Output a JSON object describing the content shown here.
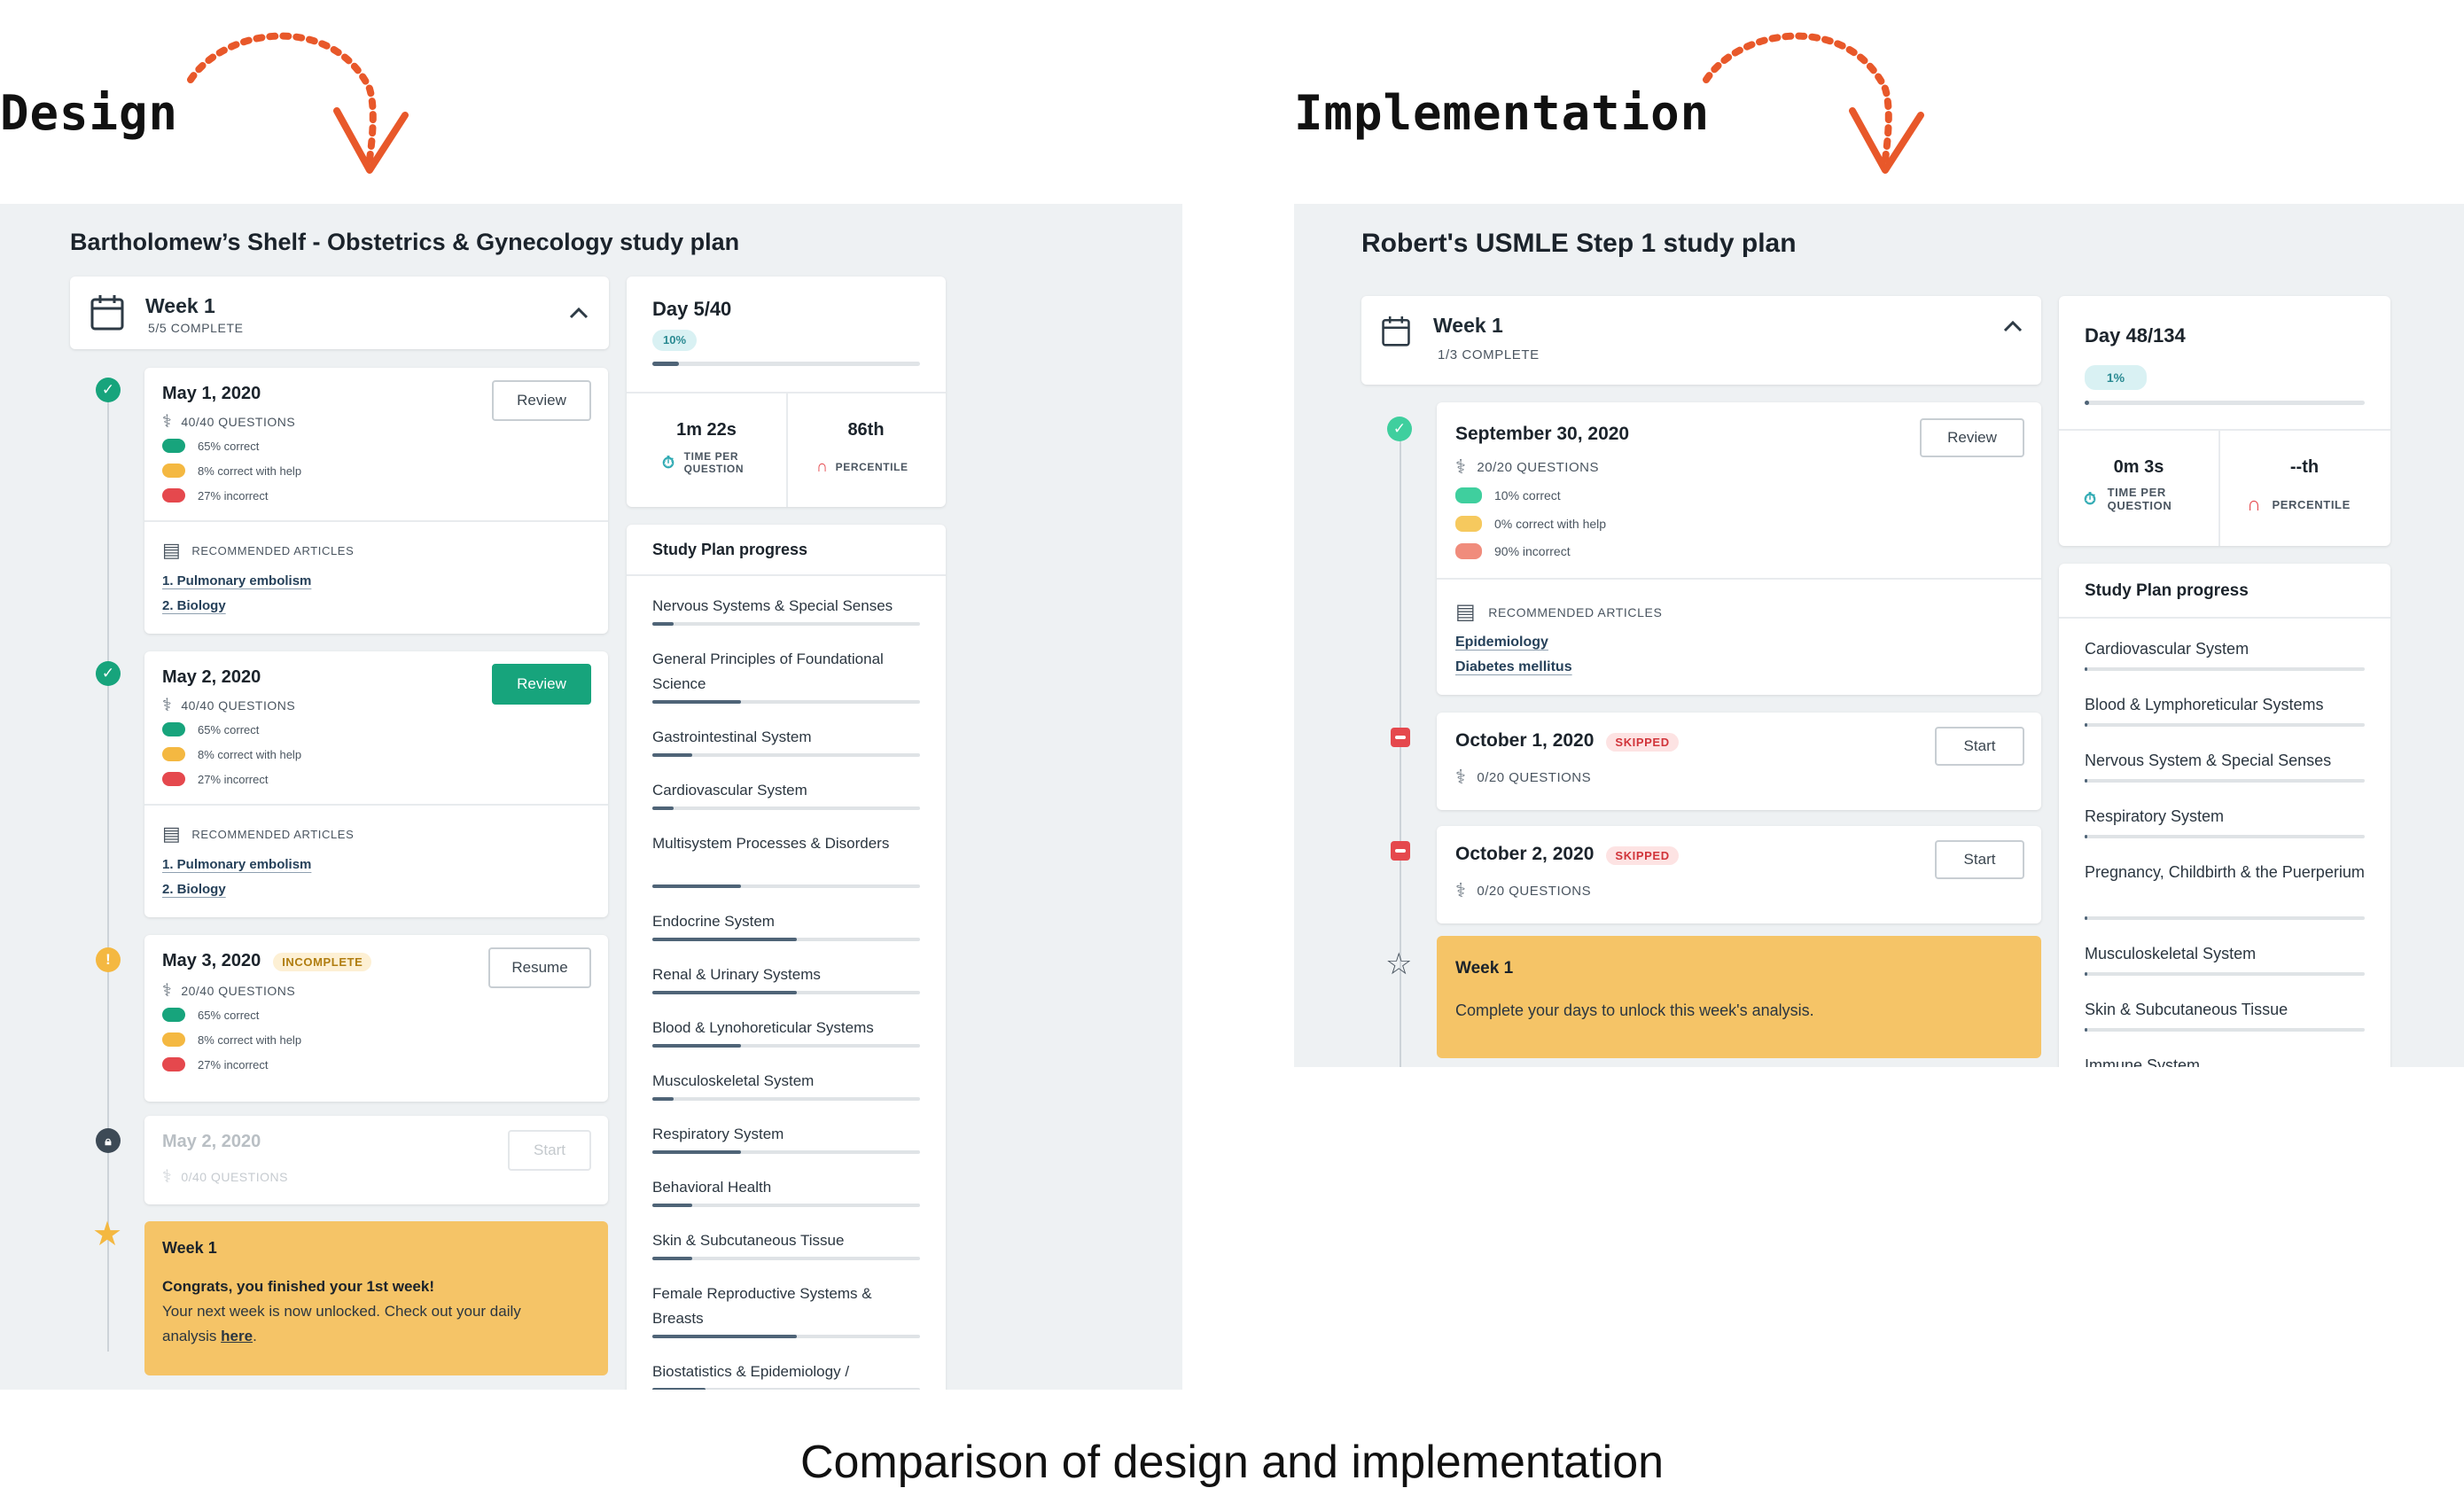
{
  "headings": {
    "design": "Design",
    "implementation": "Implementation"
  },
  "caption": "Comparison of design and implementation",
  "colors": {
    "accent_orange": "#e8582a",
    "correct": "#17a47c",
    "help": "#f4b841",
    "incorrect": "#e5484d",
    "week_card": "#f5c467",
    "panel_bg": "#eef1f3"
  },
  "design": {
    "plan_title": "Bartholomew’s Shelf - Obstetrics & Gynecology study plan",
    "week": {
      "title": "Week 1",
      "subtitle": "5/5 COMPLETE"
    },
    "days": [
      {
        "date": "May 1, 2020",
        "questions": "40/40 QUESTIONS",
        "correct": "65% correct",
        "help": "8% correct with help",
        "incorrect": "27% incorrect",
        "button": "Review",
        "articles_label": "RECOMMENDED ARTICLES",
        "articles": [
          "1. Pulmonary embolism",
          "2. Biology"
        ]
      },
      {
        "date": "May 2, 2020",
        "questions": "40/40 QUESTIONS",
        "correct": "65% correct",
        "help": "8% correct with help",
        "incorrect": "27% incorrect",
        "button": "Review",
        "articles_label": "RECOMMENDED ARTICLES",
        "articles": [
          "1. Pulmonary embolism",
          "2. Biology"
        ]
      },
      {
        "date": "May 3, 2020",
        "badge": "INCOMPLETE",
        "questions": "20/40 QUESTIONS",
        "correct": "65% correct",
        "help": "8% correct with help",
        "incorrect": "27% incorrect",
        "button": "Resume"
      },
      {
        "date": "May 2, 2020",
        "questions": "0/40 QUESTIONS",
        "button": "Start"
      }
    ],
    "week_card": {
      "title": "Week 1",
      "line1": "Congrats, you finished your 1st week!",
      "line2": "Your next week is now unlocked. Check out your daily",
      "line3_prefix": "analysis ",
      "line3_link": "here",
      "line3_suffix": "."
    },
    "day_progress": {
      "label": "Day 5/40",
      "pct_label": "10%",
      "progress": 0.1
    },
    "metrics": {
      "time_value": "1m 22s",
      "time_label_1": "TIME PER",
      "time_label_2": "QUESTION",
      "percentile_value": "86th",
      "percentile_label": "PERCENTILE"
    },
    "study_plan": {
      "title": "Study Plan progress",
      "items": [
        {
          "label": "Nervous Systems & Special Senses",
          "progress": 0.08
        },
        {
          "label": "General Principles of Foundational Science",
          "progress": 0.33
        },
        {
          "label": "Gastrointestinal System",
          "progress": 0.15
        },
        {
          "label": "Cardiovascular System",
          "progress": 0.08
        },
        {
          "label": "Multisystem Processes & Disorders",
          "progress": 0.33
        },
        {
          "label": "Endocrine System",
          "progress": 0.54
        },
        {
          "label": "Renal & Urinary Systems",
          "progress": 0.54
        },
        {
          "label": "Blood & Lynohoreticular Systems",
          "progress": 0.33
        },
        {
          "label": "Musculoskeletal System",
          "progress": 0.08
        },
        {
          "label": "Respiratory System",
          "progress": 0.33
        },
        {
          "label": "Behavioral Health",
          "progress": 0.15
        },
        {
          "label": "Skin & Subcutaneous Tissue",
          "progress": 0.15
        },
        {
          "label": "Female Reproductive Systems & Breasts",
          "progress": 0.54
        },
        {
          "label": "Biostatistics & Epidemiology /",
          "progress": 0.2
        }
      ]
    }
  },
  "implementation": {
    "plan_title": "Robert's USMLE Step 1 study plan",
    "week": {
      "title": "Week 1",
      "subtitle": "1/3 COMPLETE"
    },
    "days": [
      {
        "date": "September 30, 2020",
        "questions": "20/20 QUESTIONS",
        "correct": "10% correct",
        "help": "0% correct with help",
        "incorrect": "90% incorrect",
        "button": "Review",
        "articles_label": "RECOMMENDED ARTICLES",
        "articles": [
          "Epidemiology",
          "Diabetes mellitus"
        ]
      },
      {
        "date": "October 1, 2020",
        "badge": "SKIPPED",
        "questions": "0/20 QUESTIONS",
        "button": "Start"
      },
      {
        "date": "October 2, 2020",
        "badge": "SKIPPED",
        "questions": "0/20 QUESTIONS",
        "button": "Start"
      }
    ],
    "week_card": {
      "title": "Week 1",
      "line1": "Complete your days to unlock this week's analysis."
    },
    "day_progress": {
      "label": "Day 48/134",
      "pct_label": "1%",
      "progress": 0.01
    },
    "metrics": {
      "time_value": "0m 3s",
      "time_label_1": "TIME PER",
      "time_label_2": "QUESTION",
      "percentile_value": "--th",
      "percentile_label": "PERCENTILE"
    },
    "study_plan": {
      "title": "Study Plan progress",
      "items": [
        {
          "label": "Cardiovascular System",
          "progress": 0.01
        },
        {
          "label": "Blood & Lymphoreticular Systems",
          "progress": 0.01
        },
        {
          "label": "Nervous System & Special Senses",
          "progress": 0.01
        },
        {
          "label": "Respiratory System",
          "progress": 0.01
        },
        {
          "label": "Pregnancy, Childbirth & the Puerperium",
          "progress": 0.01
        },
        {
          "label": "Musculoskeletal System",
          "progress": 0.01
        },
        {
          "label": "Skin & Subcutaneous Tissue",
          "progress": 0.01
        },
        {
          "label": "Immune System",
          "progress": 0.0
        }
      ]
    }
  }
}
